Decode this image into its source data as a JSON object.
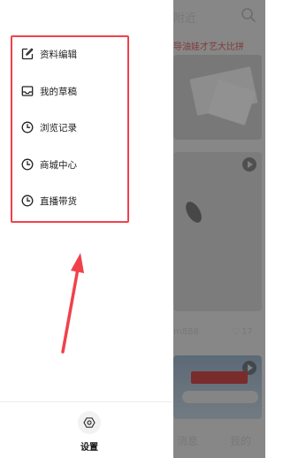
{
  "drawer": {
    "menu_items": [
      {
        "label": "资料编辑",
        "icon": "edit-icon"
      },
      {
        "label": "我的草稿",
        "icon": "inbox-icon"
      },
      {
        "label": "浏览记录",
        "icon": "clock-icon"
      },
      {
        "label": "商城中心",
        "icon": "clock-icon"
      },
      {
        "label": "直播带货",
        "icon": "clock-icon"
      }
    ],
    "settings": {
      "label": "设置",
      "icon": "settings-icon"
    }
  },
  "background": {
    "tab_nearby": "附近",
    "title_fragment": "导油娃才艺大比拼",
    "username_fragment": "m888",
    "like_count": "17",
    "nav": {
      "messages": "消息",
      "me": "我的"
    }
  },
  "colors": {
    "highlight_border": "#f0414b",
    "arrow": "#f0414b"
  }
}
